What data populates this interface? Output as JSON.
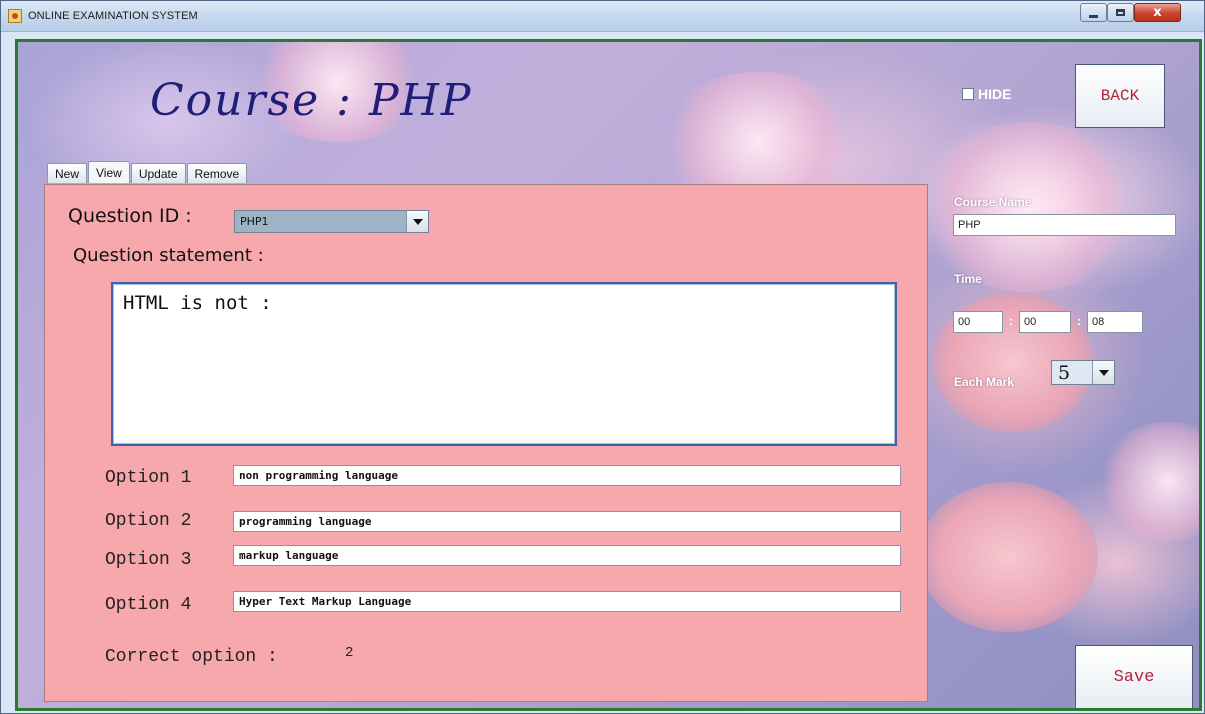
{
  "window": {
    "title": "ONLINE EXAMINATION SYSTEM",
    "close_glyph": "x"
  },
  "header": {
    "course_title": "Course : PHP"
  },
  "tabs": [
    {
      "label": "New"
    },
    {
      "label": "View"
    },
    {
      "label": "Update"
    },
    {
      "label": "Remove"
    }
  ],
  "form": {
    "question_id_label": "Question ID :",
    "question_id_value": "PHP1",
    "statement_label": "Question statement :",
    "statement_value": "HTML is not :",
    "options": [
      {
        "label": "Option 1",
        "value": "non programming language"
      },
      {
        "label": "Option 2",
        "value": "programming language"
      },
      {
        "label": "Option 3",
        "value": "markup language"
      },
      {
        "label": "Option 4",
        "value": "Hyper Text Markup Language"
      }
    ],
    "correct_label": "Correct option :",
    "correct_value": "2"
  },
  "sidebar": {
    "hide_label": "HIDE",
    "back_label": "BACK",
    "course_name_label": "Course Name",
    "course_name_value": "PHP",
    "time_label": "Time",
    "time": {
      "hours": "00",
      "minutes": "00",
      "seconds": "08",
      "separator": ":"
    },
    "each_mark_label": "Each Mark",
    "each_mark_value": "5",
    "save_label": "Save"
  },
  "colors": {
    "panel_bg": "#f7a8ad",
    "frame_border": "#2b7a2f",
    "button_text": "#b3243a",
    "title_text": "#1f1f78"
  }
}
